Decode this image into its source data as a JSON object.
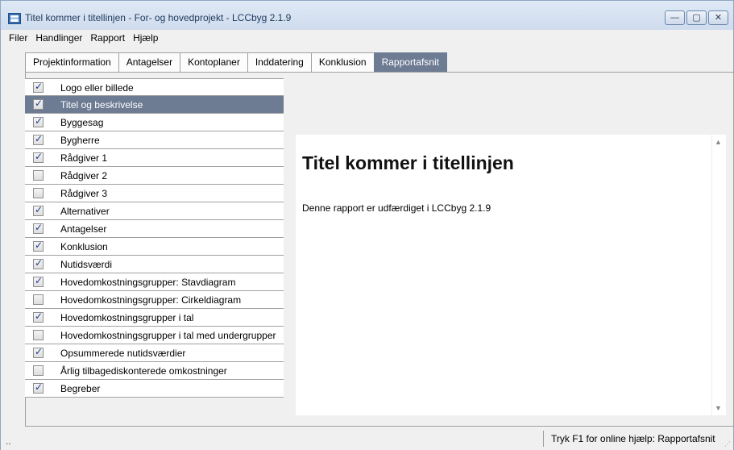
{
  "window": {
    "title": "Titel kommer i titellinjen - For- og hovedprojekt - LCCbyg 2.1.9",
    "minimize_glyph": "—",
    "maximize_glyph": "▢",
    "close_glyph": "✕"
  },
  "menu": [
    "Filer",
    "Handlinger",
    "Rapport",
    "Hjælp"
  ],
  "tabs": [
    {
      "label": "Projektinformation",
      "active": false
    },
    {
      "label": "Antagelser",
      "active": false
    },
    {
      "label": "Kontoplaner",
      "active": false
    },
    {
      "label": "Inddatering",
      "active": false
    },
    {
      "label": "Konklusion",
      "active": false
    },
    {
      "label": "Rapportafsnit",
      "active": true
    }
  ],
  "sections": [
    {
      "label": "Logo eller billede",
      "checked": true,
      "selected": false
    },
    {
      "label": "Titel og beskrivelse",
      "checked": true,
      "selected": true
    },
    {
      "label": "Byggesag",
      "checked": true,
      "selected": false
    },
    {
      "label": "Bygherre",
      "checked": true,
      "selected": false
    },
    {
      "label": "Rådgiver 1",
      "checked": true,
      "selected": false
    },
    {
      "label": "Rådgiver 2",
      "checked": false,
      "selected": false
    },
    {
      "label": "Rådgiver 3",
      "checked": false,
      "selected": false
    },
    {
      "label": "Alternativer",
      "checked": true,
      "selected": false
    },
    {
      "label": "Antagelser",
      "checked": true,
      "selected": false
    },
    {
      "label": "Konklusion",
      "checked": true,
      "selected": false
    },
    {
      "label": "Nutidsværdi",
      "checked": true,
      "selected": false
    },
    {
      "label": "Hovedomkostningsgrupper: Stavdiagram",
      "checked": true,
      "selected": false
    },
    {
      "label": "Hovedomkostningsgrupper: Cirkeldiagram",
      "checked": false,
      "selected": false
    },
    {
      "label": "Hovedomkostningsgrupper i tal",
      "checked": true,
      "selected": false
    },
    {
      "label": "Hovedomkostningsgrupper i tal med undergrupper",
      "checked": false,
      "selected": false
    },
    {
      "label": "Opsummerede nutidsværdier",
      "checked": true,
      "selected": false
    },
    {
      "label": "Årlig tilbagediskonterede omkostninger",
      "checked": false,
      "selected": false
    },
    {
      "label": "Begreber",
      "checked": true,
      "selected": false
    }
  ],
  "preview": {
    "title": "Titel kommer i titellinjen",
    "text": "Denne rapport er udfærdiget i LCCbyg 2.1.9"
  },
  "status": {
    "left": "..",
    "help": "Tryk F1 for online hjælp: Rapportafsnit"
  }
}
